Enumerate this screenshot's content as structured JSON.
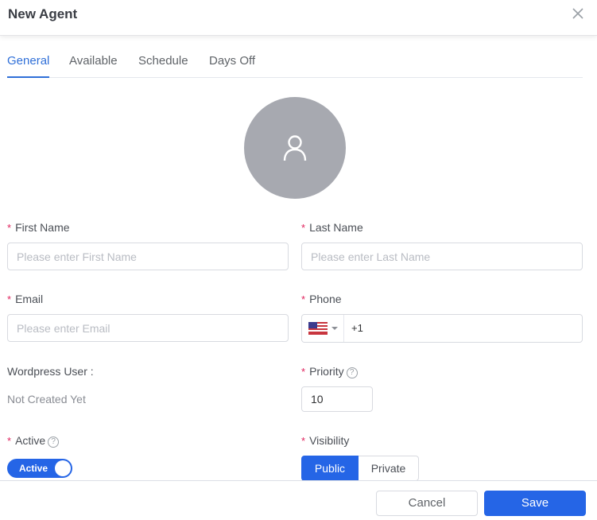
{
  "dialog": {
    "title": "New Agent",
    "close_icon": "close-icon"
  },
  "tabs": [
    {
      "label": "General",
      "active": true
    },
    {
      "label": "Available",
      "active": false
    },
    {
      "label": "Schedule",
      "active": false
    },
    {
      "label": "Days Off",
      "active": false
    }
  ],
  "avatar": {
    "icon": "user-icon"
  },
  "form": {
    "first_name": {
      "label": "First Name",
      "required": "*",
      "placeholder": "Please enter First Name",
      "value": ""
    },
    "last_name": {
      "label": "Last Name",
      "required": "*",
      "placeholder": "Please enter Last Name",
      "value": ""
    },
    "email": {
      "label": "Email",
      "required": "*",
      "placeholder": "Please enter Email",
      "value": ""
    },
    "phone": {
      "label": "Phone",
      "required": "*",
      "country_flag": "us-flag-icon",
      "value": "+1"
    },
    "wordpress_user": {
      "label": "Wordpress User :",
      "value": "Not Created Yet"
    },
    "priority": {
      "label": "Priority",
      "required": "*",
      "help": "?",
      "value": "10"
    },
    "active": {
      "label": "Active",
      "required": "*",
      "help": "?",
      "toggle_label": "Active",
      "on": true
    },
    "visibility": {
      "label": "Visibility",
      "required": "*",
      "options": [
        "Public",
        "Private"
      ],
      "selected": "Public"
    }
  },
  "footer": {
    "cancel_label": "Cancel",
    "save_label": "Save"
  },
  "colors": {
    "accent": "#2565e6",
    "tab_active": "#2f6fd8",
    "required": "#e0245e",
    "avatar_bg": "#a7a9b0"
  }
}
